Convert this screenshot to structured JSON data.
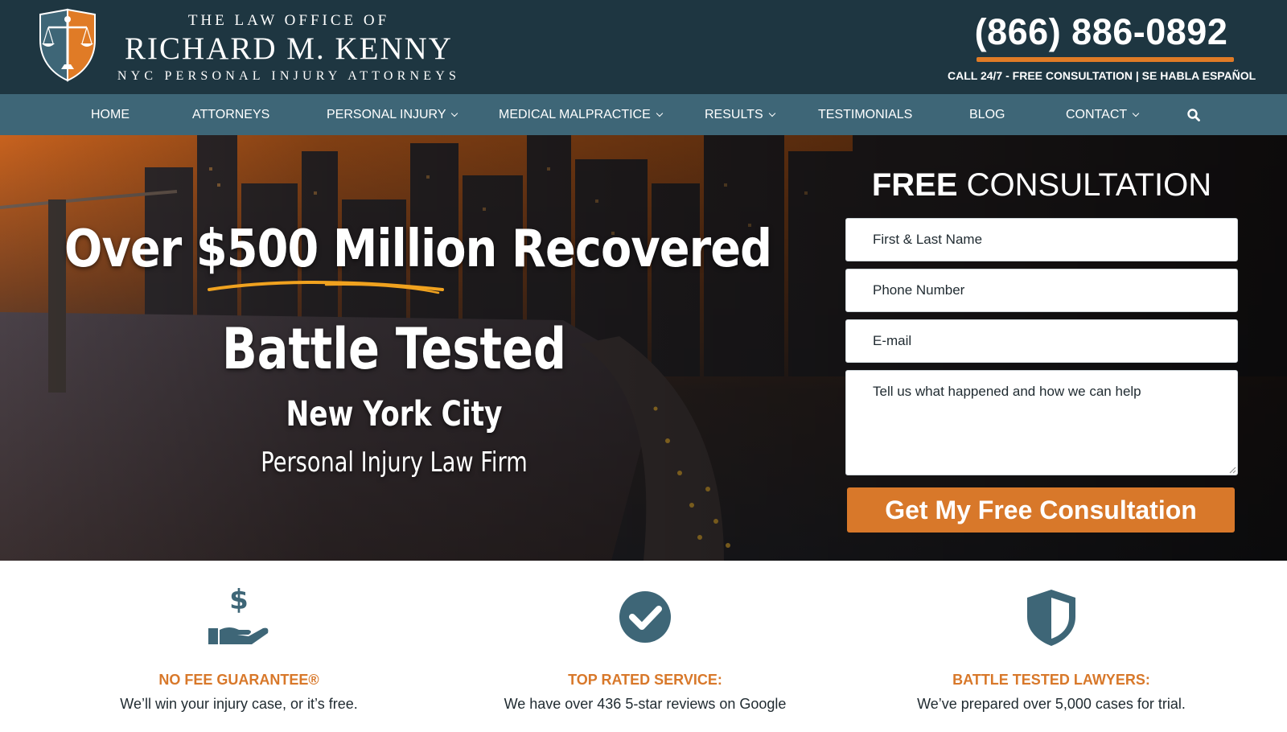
{
  "header": {
    "logo_line1": "THE LAW OFFICE OF",
    "logo_line2": "RICHARD M. KENNY",
    "logo_line3": "NYC PERSONAL INJURY ATTORNEYS",
    "phone": "(866) 886-0892",
    "callout": "CALL 24/7 - FREE CONSULTATION | SE HABLA ESPAÑOL"
  },
  "nav": {
    "items": [
      {
        "label": "HOME"
      },
      {
        "label": "ATTORNEYS"
      },
      {
        "label": "PERSONAL INJURY"
      },
      {
        "label": "MEDICAL MALPRACTICE"
      },
      {
        "label": "RESULTS"
      },
      {
        "label": "TESTIMONIALS"
      },
      {
        "label": "BLOG"
      },
      {
        "label": "CONTACT"
      }
    ]
  },
  "hero": {
    "headline": "Over $500 Million Recovered",
    "sub1": "Battle Tested",
    "sub2": "New York City",
    "sub3": "Personal Injury Law Firm"
  },
  "form": {
    "title_bold": "FREE",
    "title_rest": "CONSULTATION",
    "name_placeholder": "First & Last Name",
    "phone_placeholder": "Phone Number",
    "email_placeholder": "E-mail",
    "message_placeholder": "Tell us what happened and how we can help",
    "submit_label": "Get My Free Consultation"
  },
  "features": [
    {
      "icon": "hand-dollar-icon",
      "title": "NO FEE GUARANTEE®",
      "desc": "We’ll win your injury case, or it’s free."
    },
    {
      "icon": "check-circle-icon",
      "title": "TOP RATED SERVICE:",
      "desc": "We have over 436 5-star reviews on Google"
    },
    {
      "icon": "shield-icon",
      "title": "BATTLE TESTED LAWYERS:",
      "desc": "We’ve prepared over 5,000 cases for trial."
    }
  ],
  "colors": {
    "header_bg": "#1e3641",
    "nav_bg": "#3e6677",
    "accent": "#d8782a",
    "icon": "#3e6677"
  }
}
